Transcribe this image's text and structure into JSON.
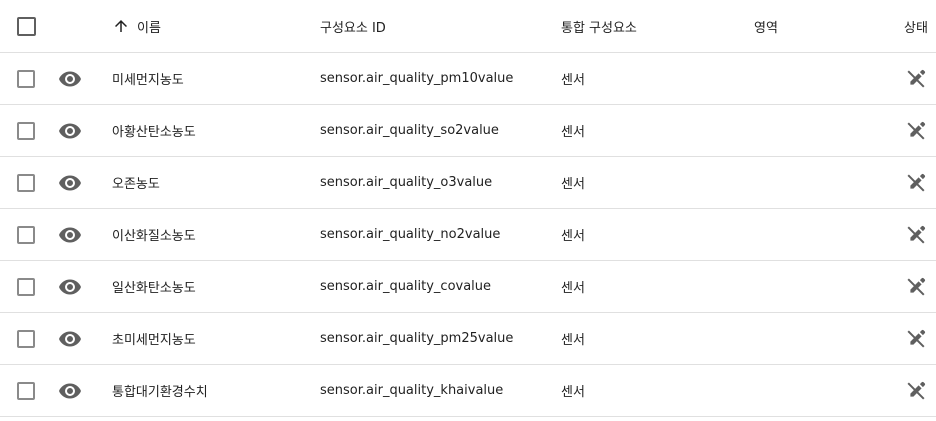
{
  "header": {
    "name": "이름",
    "entity_id": "구성요소 ID",
    "integration": "통합 구성요소",
    "area": "영역",
    "status": "상태",
    "sort_icon": "arrow-up-icon"
  },
  "rows": [
    {
      "name": "미세먼지농도",
      "entity_id": "sensor.air_quality_pm10value",
      "integration": "센서",
      "area": ""
    },
    {
      "name": "아황산탄소농도",
      "entity_id": "sensor.air_quality_so2value",
      "integration": "센서",
      "area": ""
    },
    {
      "name": "오존농도",
      "entity_id": "sensor.air_quality_o3value",
      "integration": "센서",
      "area": ""
    },
    {
      "name": "이산화질소농도",
      "entity_id": "sensor.air_quality_no2value",
      "integration": "센서",
      "area": ""
    },
    {
      "name": "일산화탄소농도",
      "entity_id": "sensor.air_quality_covalue",
      "integration": "센서",
      "area": ""
    },
    {
      "name": "초미세먼지농도",
      "entity_id": "sensor.air_quality_pm25value",
      "integration": "센서",
      "area": ""
    },
    {
      "name": "통합대기환경수치",
      "entity_id": "sensor.air_quality_khaivalue",
      "integration": "센서",
      "area": ""
    }
  ],
  "icons": {
    "row_visibility": "eye-icon",
    "row_status": "pencil-off-icon"
  },
  "colors": {
    "icon": "#5f5f5f",
    "divider": "#e0e0e0",
    "checkbox_border": "#8a8a8a"
  }
}
